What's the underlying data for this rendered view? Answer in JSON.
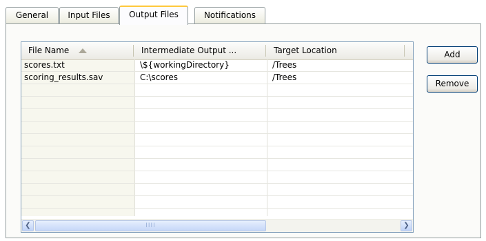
{
  "tabs": [
    {
      "label": "General"
    },
    {
      "label": "Input Files"
    },
    {
      "label": "Output Files",
      "active": true
    },
    {
      "label": "Notifications"
    }
  ],
  "table": {
    "columns": [
      "File Name",
      "Intermediate Output ...",
      "Target Location"
    ],
    "sort_column": "File Name",
    "rows": [
      [
        "scores.txt",
        "\\${workingDirectory}",
        "/Trees"
      ],
      [
        "scoring_results.sav",
        "C:\\scores",
        "/Trees"
      ]
    ]
  },
  "buttons": {
    "add": "Add",
    "remove": "Remove"
  },
  "scrollbar": {
    "left_icon": "arrow-left-icon",
    "right_icon": "arrow-right-icon",
    "thumb_grip": "IIII"
  },
  "colors": {
    "tab_active_accent": "#ffc83c",
    "border": "#919b9c",
    "button_border": "#003c74"
  }
}
